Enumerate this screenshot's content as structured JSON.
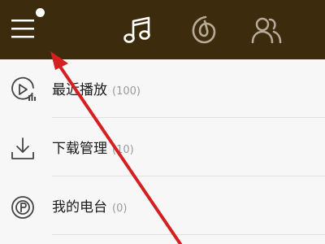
{
  "colors": {
    "topbar_bg": "#3c2c0d",
    "list_bg": "#f7f7f7",
    "annotation_arrow": "#d42020"
  },
  "topbar": {
    "icons": [
      "menu-icon",
      "music-note-icon",
      "netease-disc-icon",
      "friends-icon"
    ],
    "has_notification_dot": true
  },
  "menu_items": [
    {
      "label": "最近播放",
      "count": "(100)",
      "icon": "recent-play-icon"
    },
    {
      "label": "下载管理",
      "count": "(10)",
      "icon": "download-icon"
    },
    {
      "label": "我的电台",
      "count": "(0)",
      "icon": "radio-icon"
    }
  ]
}
